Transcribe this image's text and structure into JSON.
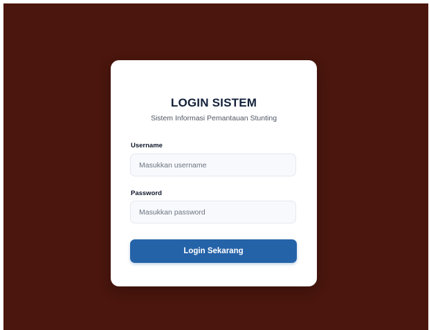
{
  "login": {
    "title": "LOGIN SISTEM",
    "subtitle": "Sistem Informasi Pemantauan Stunting",
    "username_label": "Username",
    "username_placeholder": "Masukkan username",
    "username_value": "",
    "password_label": "Password",
    "password_placeholder": "Masukkan password",
    "password_value": "",
    "submit_label": "Login Sekarang"
  },
  "colors": {
    "backdrop": "#4a160d",
    "card": "#ffffff",
    "primary_button": "#2563a8",
    "title_text": "#14213a"
  }
}
